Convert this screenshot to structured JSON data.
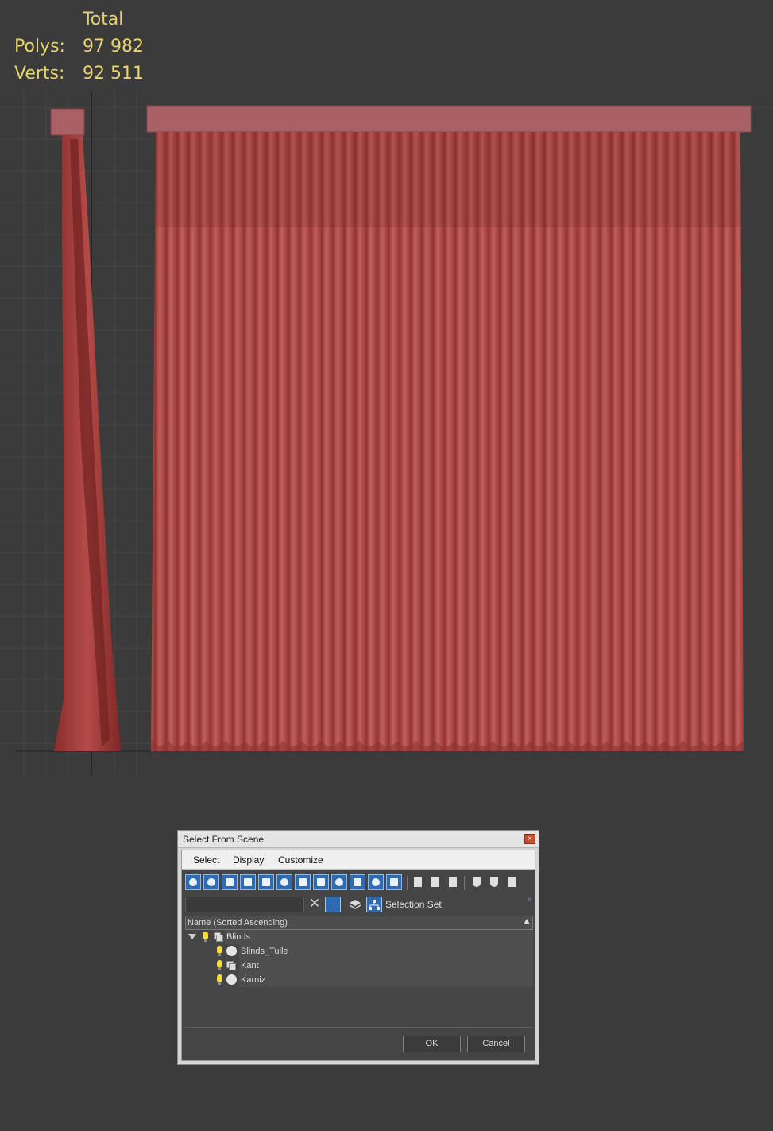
{
  "stats": {
    "header": "Total",
    "polys_label": "Polys:",
    "polys_value": "97 982",
    "verts_label": "Verts:",
    "verts_value": "92 511",
    "color": "#e6d46a"
  },
  "viewport": {
    "background": "#3b3b3b",
    "curtain_color": "#b34a48",
    "rail_color": "#a96166"
  },
  "dialog": {
    "title": "Select From Scene",
    "close_icon": "close-icon",
    "menu": [
      "Select",
      "Display",
      "Customize"
    ],
    "toolbar_icons": [
      "geometry-icon",
      "shapes-icon",
      "lights-icon",
      "cameras-icon",
      "helpers-icon",
      "space-warps-icon",
      "groups-icon",
      "xrefs-icon",
      "bones-icon",
      "containers-icon",
      "frozen-icon",
      "hidden-icon",
      "display-all-icon",
      "display-none-icon",
      "invert-display-icon",
      "filter-icon",
      "filter-options-icon",
      "collapse-icon"
    ],
    "selection_set_label": "Selection Set:",
    "column_header": "Name (Sorted Ascending)",
    "tree": [
      {
        "label": "Blinds",
        "level": 0,
        "type": "group",
        "expanded": true
      },
      {
        "label": "Blinds_Tulle",
        "level": 1,
        "type": "object"
      },
      {
        "label": "Kant",
        "level": 1,
        "type": "group"
      },
      {
        "label": "Karniz",
        "level": 1,
        "type": "object"
      }
    ],
    "ok_label": "OK",
    "cancel_label": "Cancel",
    "accent": "#2f6bb3"
  }
}
